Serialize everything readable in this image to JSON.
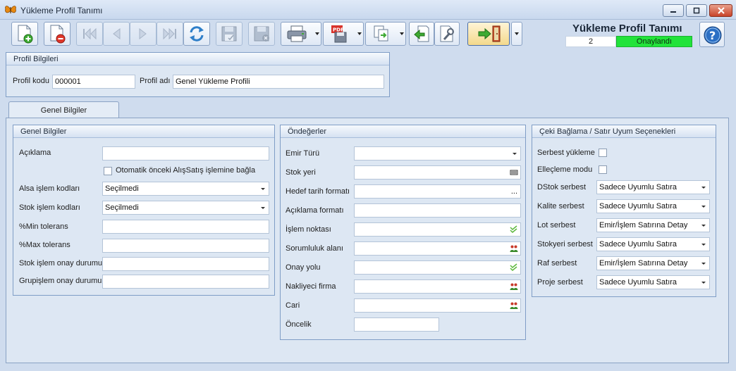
{
  "window": {
    "title": "Yükleme Profil Tanımı"
  },
  "header": {
    "title": "Yükleme Profil Tanımı",
    "number": "2",
    "status": "Onaylandı",
    "status_color": "#22e33a"
  },
  "toolbar": {
    "icons": [
      "new-document-icon",
      "delete-document-icon",
      "first-record-icon",
      "previous-record-icon",
      "next-record-icon",
      "last-record-icon",
      "refresh-icon",
      "save-icon",
      "save-close-icon",
      "print-icon",
      "pdf-export-icon",
      "copy-export-icon",
      "back-icon",
      "settings-icon",
      "exit-icon",
      "help-icon"
    ]
  },
  "profile": {
    "section_title": "Profil Bilgileri",
    "code_label": "Profil kodu",
    "code_value": "000001",
    "name_label": "Profil adı",
    "name_value": "Genel Yükleme Profili"
  },
  "tabs": [
    {
      "label": "Genel Bilgiler",
      "active": true
    }
  ],
  "general": {
    "title": "Genel Bilgiler",
    "description_label": "Açıklama",
    "description_value": "",
    "auto_checkbox_label": "Otomatik önceki AlışSatış işlemine bağla",
    "alsa_label": "Alsa işlem kodları",
    "alsa_value": "Seçilmedi",
    "stock_codes_label": "Stok işlem kodları",
    "stock_codes_value": "Seçilmedi",
    "min_tol_label": "%Min tolerans",
    "min_tol_value": "",
    "max_tol_label": "%Max tolerans",
    "max_tol_value": "",
    "stock_approval_label": "Stok işlem onay durumu",
    "stock_approval_value": "",
    "group_approval_label": "Grupişlem onay durumu",
    "group_approval_value": ""
  },
  "defaults": {
    "title": "Öndeğerler",
    "order_type_label": "Emir Türü",
    "stock_location_label": "Stok yeri",
    "target_date_format_label": "Hedef tarih formatı",
    "target_date_format_button": "...",
    "description_format_label": "Açıklama formatı",
    "process_point_label": "İşlem noktası",
    "responsibility_area_label": "Sorumluluk alanı",
    "approval_path_label": "Onay yolu",
    "carrier_label": "Nakliyeci firma",
    "account_label": "Cari",
    "priority_label": "Öncelik"
  },
  "matching": {
    "title": "Çeki Bağlama / Satır Uyum Seçenekleri",
    "free_loading_label": "Serbest yükleme",
    "handling_mode_label": "Elleçleme modu",
    "dstock_label": "DStok serbest",
    "dstock_value": "Sadece Uyumlu Satıra",
    "quality_label": "Kalite serbest",
    "quality_value": "Sadece Uyumlu Satıra",
    "lot_label": "Lot serbest",
    "lot_value": "Emir/İşlem Satırına Detay",
    "stock_location_label": "Stokyeri serbest",
    "stock_location_value": "Sadece Uyumlu Satıra",
    "shelf_label": "Raf serbest",
    "shelf_value": "Emir/İşlem Satırına Detay",
    "project_label": "Proje serbest",
    "project_value": "Sadece Uyumlu Satıra"
  }
}
